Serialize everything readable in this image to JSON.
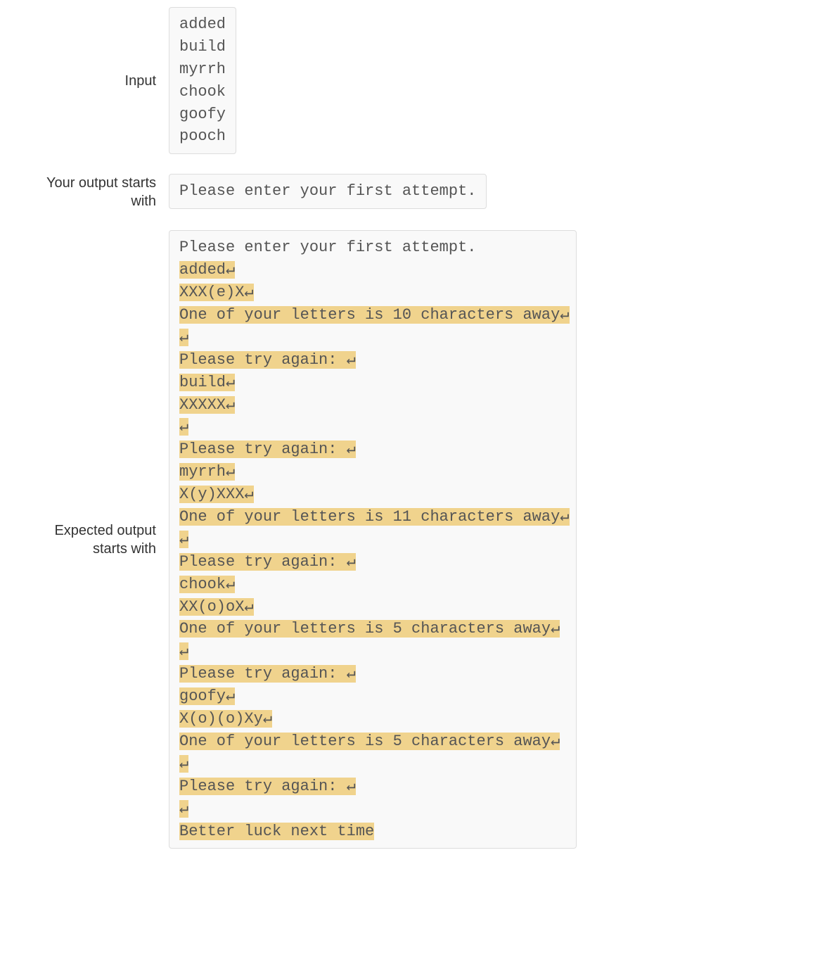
{
  "labels": {
    "input": "Input",
    "your_output": "Your output starts with",
    "expected_output": "Expected output starts with"
  },
  "nl_symbol": "↵",
  "input_lines": [
    "added",
    "build",
    "myrrh",
    "chook",
    "goofy",
    "pooch"
  ],
  "your_output_lines": [
    {
      "text": "Please enter your first attempt.",
      "diff": false,
      "nl": false
    }
  ],
  "expected_output_lines": [
    {
      "text": "Please enter your first attempt.",
      "diff": false,
      "nl": false
    },
    {
      "text": "added",
      "diff": true,
      "nl": true
    },
    {
      "text": "XXX(e)X",
      "diff": true,
      "nl": true
    },
    {
      "text": "One of your letters is 10 characters away",
      "diff": true,
      "nl": true
    },
    {
      "text": "",
      "diff": true,
      "nl": true
    },
    {
      "text": "Please try again: ",
      "diff": true,
      "nl": true
    },
    {
      "text": "build",
      "diff": true,
      "nl": true
    },
    {
      "text": "XXXXX",
      "diff": true,
      "nl": true
    },
    {
      "text": "",
      "diff": true,
      "nl": true
    },
    {
      "text": "Please try again: ",
      "diff": true,
      "nl": true
    },
    {
      "text": "myrrh",
      "diff": true,
      "nl": true
    },
    {
      "text": "X(y)XXX",
      "diff": true,
      "nl": true
    },
    {
      "text": "One of your letters is 11 characters away",
      "diff": true,
      "nl": true
    },
    {
      "text": "",
      "diff": true,
      "nl": true
    },
    {
      "text": "Please try again: ",
      "diff": true,
      "nl": true
    },
    {
      "text": "chook",
      "diff": true,
      "nl": true
    },
    {
      "text": "XX(o)oX",
      "diff": true,
      "nl": true
    },
    {
      "text": "One of your letters is 5 characters away",
      "diff": true,
      "nl": true
    },
    {
      "text": "",
      "diff": true,
      "nl": true
    },
    {
      "text": "Please try again: ",
      "diff": true,
      "nl": true
    },
    {
      "text": "goofy",
      "diff": true,
      "nl": true
    },
    {
      "text": "X(o)(o)Xy",
      "diff": true,
      "nl": true
    },
    {
      "text": "One of your letters is 5 characters away",
      "diff": true,
      "nl": true
    },
    {
      "text": "",
      "diff": true,
      "nl": true
    },
    {
      "text": "Please try again: ",
      "diff": true,
      "nl": true
    },
    {
      "text": "",
      "diff": true,
      "nl": true
    },
    {
      "text": "Better luck next time",
      "diff": true,
      "nl": false
    }
  ]
}
